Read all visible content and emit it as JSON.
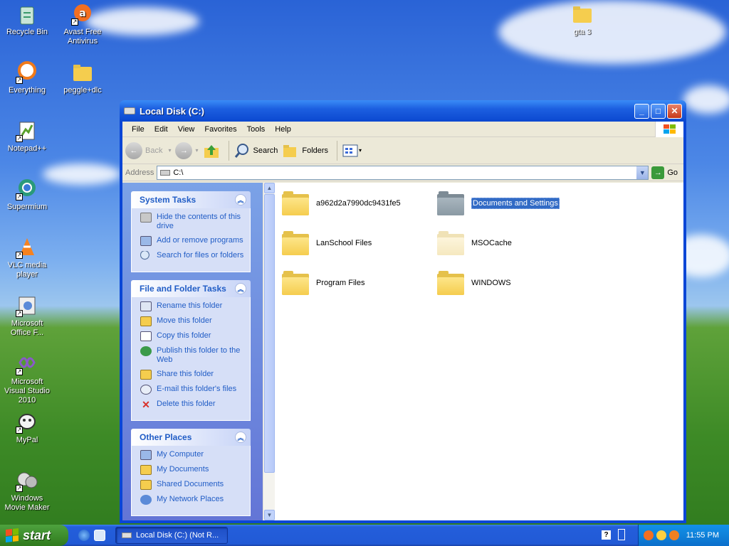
{
  "desktop": {
    "icons": [
      {
        "label": "Recycle Bin",
        "icon": "recycle-bin-icon"
      },
      {
        "label": "Avast Free Antivirus",
        "icon": "avast-icon"
      },
      {
        "label": "gta 3",
        "icon": "folder-icon"
      },
      {
        "label": "Everything",
        "icon": "everything-icon"
      },
      {
        "label": "peggle+dlc",
        "icon": "folder-icon"
      },
      {
        "label": "Notepad++",
        "icon": "notepad-plus-plus-icon"
      },
      {
        "label": "Supermium",
        "icon": "supermium-icon"
      },
      {
        "label": "VLC media player",
        "icon": "vlc-icon"
      },
      {
        "label": "Microsoft Office F...",
        "icon": "office-icon"
      },
      {
        "label": "Microsoft Visual Studio 2010",
        "icon": "visual-studio-icon"
      },
      {
        "label": "MyPal",
        "icon": "mypal-icon"
      },
      {
        "label": "Windows Movie Maker",
        "icon": "movie-maker-icon"
      }
    ]
  },
  "window": {
    "title": "Local Disk (C:)",
    "menu": [
      "File",
      "Edit",
      "View",
      "Favorites",
      "Tools",
      "Help"
    ],
    "toolbar": {
      "back": "Back",
      "search": "Search",
      "folders": "Folders"
    },
    "address": {
      "label": "Address",
      "value": "C:\\",
      "go": "Go"
    },
    "tasks": {
      "system": {
        "title": "System Tasks",
        "links": [
          "Hide the contents of this drive",
          "Add or remove programs",
          "Search for files or folders"
        ]
      },
      "file_folder": {
        "title": "File and Folder Tasks",
        "links": [
          "Rename this folder",
          "Move this folder",
          "Copy this folder",
          "Publish this folder to the Web",
          "Share this folder",
          "E-mail this folder's files",
          "Delete this folder"
        ]
      },
      "other": {
        "title": "Other Places",
        "links": [
          "My Computer",
          "My Documents",
          "Shared Documents",
          "My Network Places"
        ]
      }
    },
    "files": [
      {
        "name": "a962d2a7990dc9431fe5",
        "style": "normal"
      },
      {
        "name": "Documents and Settings",
        "style": "gray",
        "selected": true
      },
      {
        "name": "LanSchool Files",
        "style": "normal"
      },
      {
        "name": "MSOCache",
        "style": "pale"
      },
      {
        "name": "Program Files",
        "style": "normal"
      },
      {
        "name": "WINDOWS",
        "style": "normal"
      }
    ]
  },
  "taskbar": {
    "start": "start",
    "task": "Local Disk (C:) (Not R...",
    "clock": "11:55 PM"
  },
  "colors": {
    "accent": "#0a46d6",
    "link": "#215dc6",
    "selection": "#316ac5"
  }
}
